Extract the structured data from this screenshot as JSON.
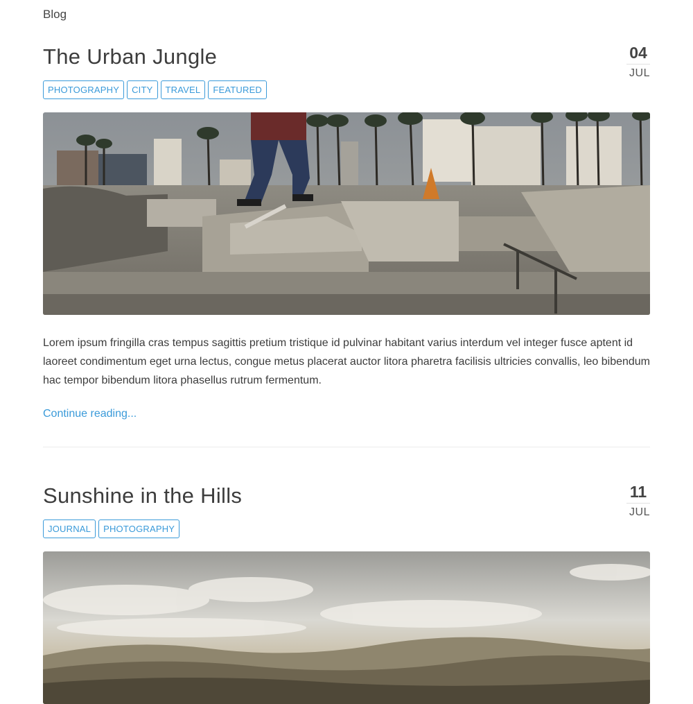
{
  "breadcrumb": "Blog",
  "posts": [
    {
      "title": "The Urban Jungle",
      "date": {
        "day": "04",
        "month": "JUL"
      },
      "tags": [
        "PHOTOGRAPHY",
        "CITY",
        "TRAVEL",
        "FEATURED"
      ],
      "image_subject": "skate park with skateboarder mid-jump, palm trees and buildings",
      "excerpt": "Lorem ipsum fringilla cras tempus sagittis pretium tristique id pulvinar habitant varius interdum vel integer fusce aptent id laoreet condimentum eget urna lectus, congue metus placerat auctor litora pharetra facilisis ultricies convallis, leo bibendum hac tempor bibendum litora phasellus rutrum fermentum.",
      "read_more": "Continue reading..."
    },
    {
      "title": "Sunshine in the Hills",
      "date": {
        "day": "11",
        "month": "JUL"
      },
      "tags": [
        "JOURNAL",
        "PHOTOGRAPHY"
      ],
      "image_subject": "cloudy sky over rolling hills"
    }
  ],
  "colors": {
    "accent": "#3a9ad9",
    "text": "#3d3d3d",
    "divider": "#ececec"
  }
}
